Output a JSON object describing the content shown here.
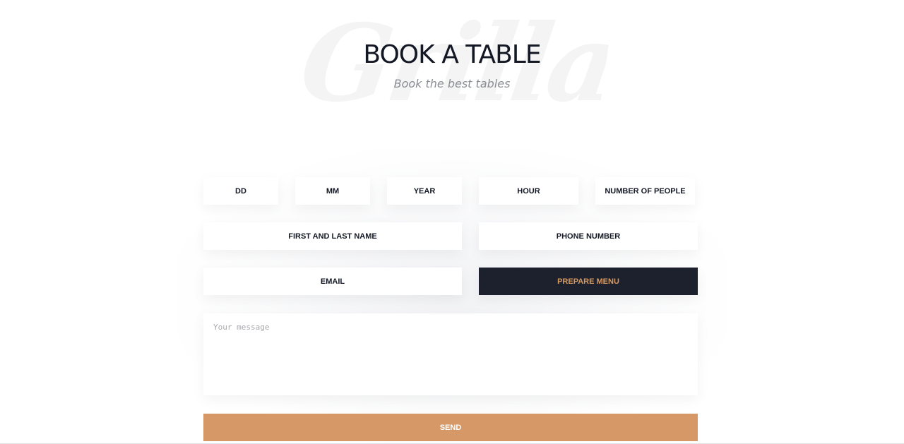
{
  "header": {
    "watermark": "Grilla",
    "title": "BOOK A TABLE",
    "subtitle": "Book the best tables"
  },
  "form": {
    "day": "DD",
    "month": "MM",
    "year": "YEAR",
    "hour": "HOUR",
    "people": "NUMBER OF PEOPLE",
    "name": "FIRST AND LAST NAME",
    "phone": "PHONE NUMBER",
    "email": "EMAIL",
    "prepare_menu": "PREPARE MENU",
    "message_placeholder": "Your message",
    "send": "SEND"
  },
  "colors": {
    "accent": "#d59866",
    "dark": "#1d212e",
    "text": "#131824"
  }
}
